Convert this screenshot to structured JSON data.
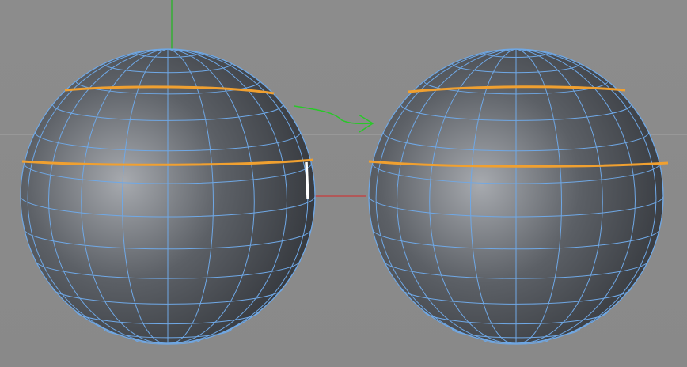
{
  "viewport": {
    "background": "#8a8a8a",
    "horizon_color": "#a6a6a6",
    "axis_y_color": "#1fb81f",
    "axis_x_color": "#c83a3a"
  },
  "colors": {
    "wireframe": "#6fa8e6",
    "selected_edge_loop": "#f0a030",
    "highlight_edge": "#ffffff",
    "annotation_arrow": "#28c828",
    "sphere_light": "#a7aaaf",
    "sphere_mid": "#5c6066",
    "sphere_dark": "#2c2f34"
  },
  "objects": [
    {
      "id": "sphere-before",
      "label": "",
      "selected_loops": 2,
      "highlighted_edges": 1
    },
    {
      "id": "sphere-after",
      "label": "",
      "selected_loops": 2,
      "highlighted_edges": 0
    }
  ],
  "icons": [
    "arrow-right-icon"
  ]
}
